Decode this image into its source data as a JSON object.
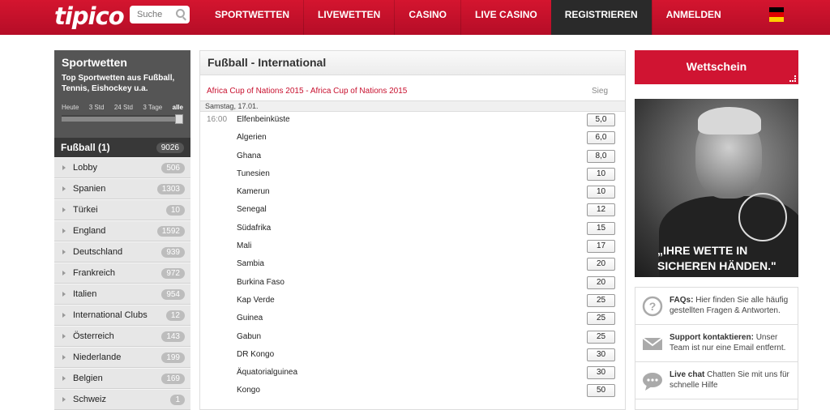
{
  "header": {
    "logo": "tipico",
    "search_placeholder": "Suche",
    "nav": [
      "SPORTWETTEN",
      "LIVEWETTEN",
      "CASINO",
      "LIVE CASINO",
      "REGISTRIEREN",
      "ANMELDEN"
    ]
  },
  "sidebar": {
    "title": "Sportwetten",
    "subtitle": "Top Sportwetten aus Fußball, Tennis, Eishockey u.a.",
    "time_filters": [
      "Heute",
      "3 Std",
      "24 Std",
      "3 Tage",
      "alle"
    ],
    "active_filter": "alle",
    "football": {
      "label": "Fußball (1)",
      "count": "9026"
    },
    "items": [
      {
        "label": "Lobby",
        "count": "506"
      },
      {
        "label": "Spanien",
        "count": "1303"
      },
      {
        "label": "Türkei",
        "count": "10"
      },
      {
        "label": "England",
        "count": "1592"
      },
      {
        "label": "Deutschland",
        "count": "939"
      },
      {
        "label": "Frankreich",
        "count": "972"
      },
      {
        "label": "Italien",
        "count": "954"
      },
      {
        "label": "International Clubs",
        "count": "12"
      },
      {
        "label": "Österreich",
        "count": "143"
      },
      {
        "label": "Niederlande",
        "count": "199"
      },
      {
        "label": "Belgien",
        "count": "169"
      },
      {
        "label": "Schweiz",
        "count": "1"
      }
    ]
  },
  "main": {
    "title": "Fußball - International",
    "competition": "Africa Cup of Nations 2015 - Africa Cup of Nations 2015",
    "column": "Sieg",
    "date": "Samstag, 17.01.",
    "time": "16:00",
    "matches": [
      {
        "team": "Elfenbeinküste",
        "odds": "5,0"
      },
      {
        "team": "Algerien",
        "odds": "6,0"
      },
      {
        "team": "Ghana",
        "odds": "8,0"
      },
      {
        "team": "Tunesien",
        "odds": "10"
      },
      {
        "team": "Kamerun",
        "odds": "10"
      },
      {
        "team": "Senegal",
        "odds": "12"
      },
      {
        "team": "Südafrika",
        "odds": "15"
      },
      {
        "team": "Mali",
        "odds": "17"
      },
      {
        "team": "Sambia",
        "odds": "20"
      },
      {
        "team": "Burkina Faso",
        "odds": "20"
      },
      {
        "team": "Kap Verde",
        "odds": "25"
      },
      {
        "team": "Guinea",
        "odds": "25"
      },
      {
        "team": "Gabun",
        "odds": "25"
      },
      {
        "team": "DR Kongo",
        "odds": "30"
      },
      {
        "team": "Äquatorialguinea",
        "odds": "30"
      },
      {
        "team": "Kongo",
        "odds": "50"
      }
    ]
  },
  "right": {
    "wettschein": "Wettschein",
    "promo_line1": "„IHRE WETTE IN",
    "promo_line2": "SICHEREN HÄNDEN.\"",
    "help": [
      {
        "title": "FAQs:",
        "text": "Hier finden Sie alle häufig gestellten Fragen & Antworten."
      },
      {
        "title": "Support kontaktieren:",
        "text": "Unser Team ist nur eine Email entfernt."
      },
      {
        "title": "Live chat",
        "text": "Chatten Sie mit uns für schnelle Hilfe"
      }
    ]
  },
  "colors": {
    "brand_red": "#c8102e",
    "sidebar_dark": "#555555"
  }
}
